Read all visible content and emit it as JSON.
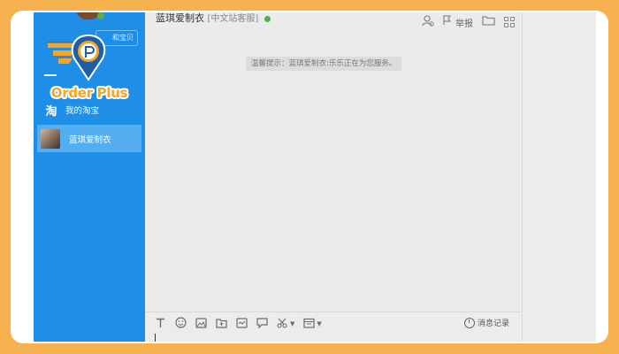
{
  "brand": {
    "name": "Order Plus",
    "colors": {
      "frame": "#f5b24e",
      "logo_orange": "#f6a623",
      "logo_blue": "#1e5fa8",
      "sidebar": "#1f8ee6"
    }
  },
  "sidebar": {
    "search_label": "和宝贝",
    "items": [
      {
        "label": "我的淘宝",
        "icon": "taobao-icon"
      },
      {
        "label": "蓝琪爱制衣",
        "icon": "contact-avatar",
        "selected": true
      }
    ]
  },
  "chat": {
    "title": "蓝琪爱制衣",
    "subtitle": "[中文站客服]",
    "header_actions": [
      {
        "icon": "user-icon"
      },
      {
        "label": "举报",
        "icon": "report-icon"
      },
      {
        "icon": "folder-icon"
      },
      {
        "icon": "grid-icon"
      }
    ],
    "notice": "温馨提示：蓝琪爱制衣:乐乐正在为您服务。",
    "toolbar": {
      "icons": [
        "text-format-icon",
        "emoji-icon",
        "image-icon",
        "folder-icon",
        "screenshot-icon",
        "comment-icon",
        "scissors-icon",
        "calendar-icon"
      ],
      "history_label": "消息记录"
    }
  }
}
